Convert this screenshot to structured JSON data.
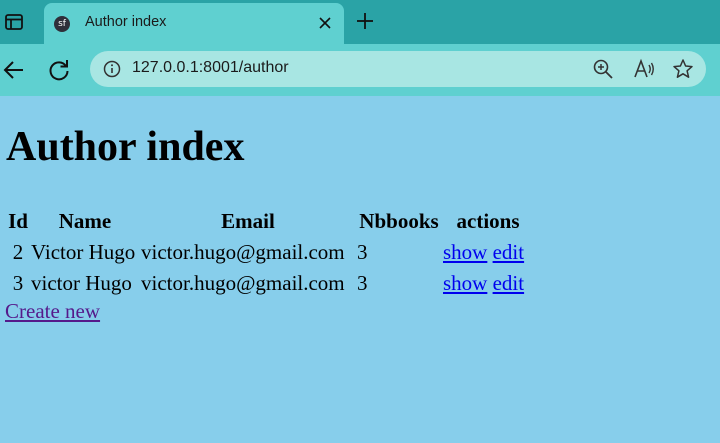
{
  "browser": {
    "tab": {
      "favicon": "sf",
      "title": "Author index"
    },
    "address": {
      "url": "127.0.0.1:8001/author"
    }
  },
  "page": {
    "heading": "Author index",
    "table": {
      "headers": [
        "Id",
        "Name",
        "Email",
        "Nbbooks",
        "actions"
      ],
      "rows": [
        {
          "id": "2",
          "name": "Victor Hugo",
          "email": "victor.hugo@gmail.com",
          "nbbooks": "3",
          "show": "show",
          "edit": "edit"
        },
        {
          "id": "3",
          "name": "victor Hugo",
          "email": "victor.hugo@gmail.com",
          "nbbooks": "3",
          "show": "show",
          "edit": "edit"
        }
      ]
    },
    "create_link": "Create new"
  },
  "icons": {
    "tab_switcher": "tab-actions-icon",
    "close": "close-icon",
    "new_tab": "plus-icon",
    "back": "back-arrow-icon",
    "reload": "reload-icon",
    "info": "info-icon",
    "zoom": "zoom-in-icon",
    "read_aloud": "read-aloud-icon",
    "favorite": "star-icon"
  },
  "colors": {
    "tabbar": "#2aa3a6",
    "toolbar": "#5fd0d0",
    "address": "#a8e6e3",
    "page_background": "#87ceeb",
    "link": "#0000ee",
    "visited_link": "#551a8b"
  }
}
